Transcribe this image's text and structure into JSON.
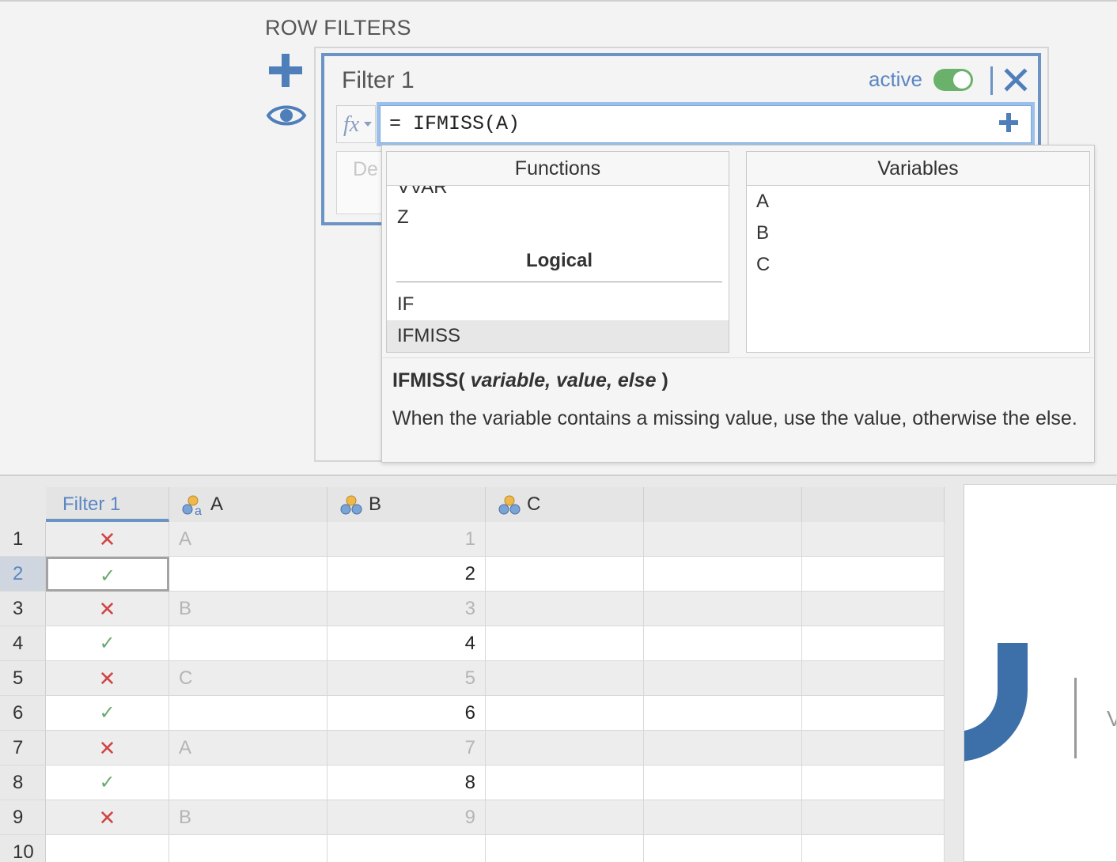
{
  "panel": {
    "title": "ROW FILTERS"
  },
  "filter": {
    "title": "Filter 1",
    "active_label": "active",
    "active": true,
    "formula": "= IFMISS(A)",
    "fx_label": "fx",
    "description_placeholder": "De"
  },
  "dropdown": {
    "functions_header": "Functions",
    "variables_header": "Variables",
    "functions_cut_item": "VVAR",
    "functions_items_top": [
      "Z"
    ],
    "category": "Logical",
    "functions_items_logical": [
      "IF",
      "IFMISS"
    ],
    "selected_function": "IFMISS",
    "variables": [
      "A",
      "B",
      "C"
    ],
    "signature_name": "IFMISS(",
    "signature_params": " variable, value, else ",
    "signature_close": ")",
    "description": "When the variable contains a missing value, use the value, otherwise the else."
  },
  "spreadsheet": {
    "columns": [
      "Filter 1",
      "A",
      "B",
      "C"
    ],
    "rows": [
      {
        "num": "1",
        "filter": "x",
        "a": "A",
        "b": "1"
      },
      {
        "num": "2",
        "filter": "check",
        "a": "",
        "b": "2"
      },
      {
        "num": "3",
        "filter": "x",
        "a": "B",
        "b": "3"
      },
      {
        "num": "4",
        "filter": "check",
        "a": "",
        "b": "4"
      },
      {
        "num": "5",
        "filter": "x",
        "a": "C",
        "b": "5"
      },
      {
        "num": "6",
        "filter": "check",
        "a": "",
        "b": "6"
      },
      {
        "num": "7",
        "filter": "x",
        "a": "A",
        "b": "7"
      },
      {
        "num": "8",
        "filter": "check",
        "a": "",
        "b": "8"
      },
      {
        "num": "9",
        "filter": "x",
        "a": "B",
        "b": "9"
      },
      {
        "num": "10",
        "filter": "",
        "a": "",
        "b": ""
      }
    ],
    "selected_row": "2"
  },
  "welcome": {
    "partial_text": "V"
  },
  "colors": {
    "accent": "#6b93c4",
    "toggle_on": "#6ab26b",
    "excluded_mark": "#d04444",
    "included_mark": "#6aaa6e",
    "logo_blue": "#3d6fa8"
  }
}
